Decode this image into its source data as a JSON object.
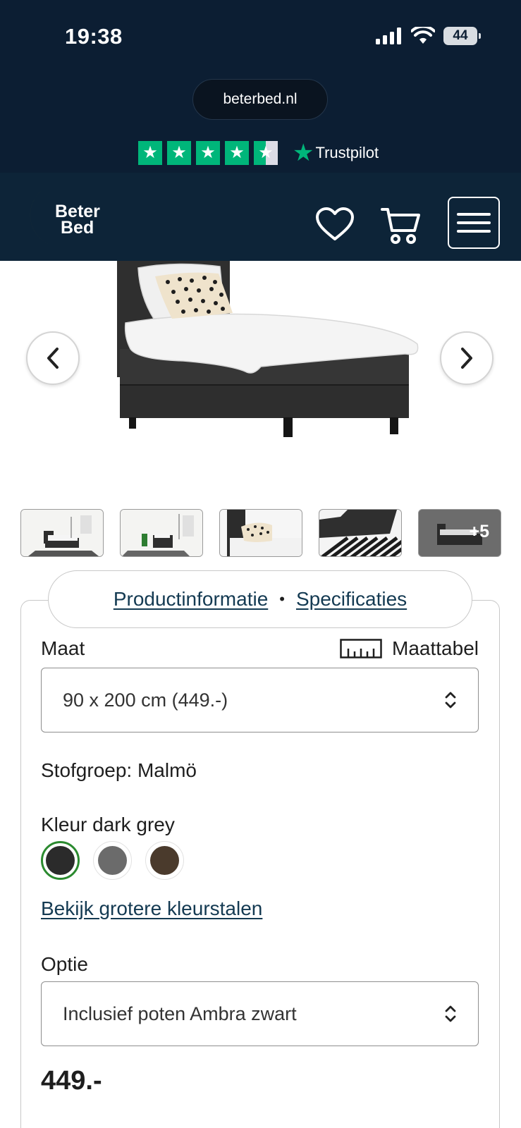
{
  "status_bar": {
    "time": "19:38",
    "battery": "44"
  },
  "browser": {
    "url": "beterbed.nl"
  },
  "trustpilot": {
    "label": "Trustpilot",
    "stars": 4.5
  },
  "header": {
    "logo_line1": "Beter",
    "logo_line2": "Bed"
  },
  "tabs": {
    "productinfo": "Productinformatie",
    "separator": "•",
    "specs": "Specificaties"
  },
  "size": {
    "label": "Maat",
    "size_chart": "Maattabel",
    "selected": "90 x 200 cm (449.-)"
  },
  "fabric": {
    "label": "Stofgroep: Malmö"
  },
  "color": {
    "label": "Kleur dark grey",
    "swatches": [
      {
        "name": "dark grey",
        "hex": "#2b2b2b",
        "selected": true
      },
      {
        "name": "grey",
        "hex": "#6b6b6b",
        "selected": false
      },
      {
        "name": "brown",
        "hex": "#4a3a2c",
        "selected": false
      }
    ],
    "larger_swatches_link": "Bekijk grotere kleurstalen"
  },
  "option": {
    "label": "Optie",
    "selected": "Inclusief poten Ambra zwart"
  },
  "price": "449.-",
  "thumbnails": {
    "more_label": "+5"
  },
  "colors": {
    "header_bg": "#0d2438",
    "trustpilot_green": "#00b67a",
    "link": "#143a52",
    "selected_swatch_ring": "#2b8a2f"
  }
}
